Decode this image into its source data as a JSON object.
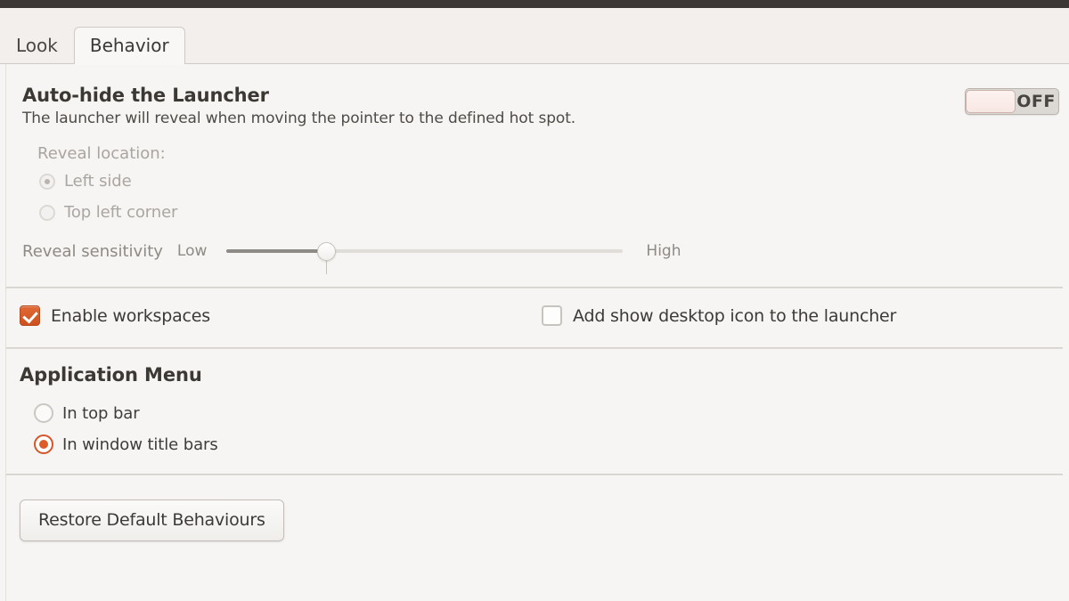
{
  "window": {
    "titlebar_color": "#3a3734"
  },
  "tabs": [
    {
      "label": "Look",
      "active": false
    },
    {
      "label": "Behavior",
      "active": true
    }
  ],
  "autohide": {
    "title": "Auto-hide the Launcher",
    "description": "The launcher will reveal when moving the pointer to the defined hot spot.",
    "toggle": {
      "state_label": "OFF",
      "on": false
    },
    "reveal_location_label": "Reveal location:",
    "reveal_options": [
      {
        "label": "Left side",
        "selected": true,
        "disabled": true
      },
      {
        "label": "Top left corner",
        "selected": false,
        "disabled": true
      }
    ],
    "sensitivity": {
      "label": "Reveal sensitivity",
      "min_label": "Low",
      "max_label": "High",
      "value_percent": 23
    }
  },
  "checkboxes": [
    {
      "label": "Enable workspaces",
      "checked": true
    },
    {
      "label": "Add show desktop icon to the launcher",
      "checked": false
    }
  ],
  "application_menu": {
    "title": "Application Menu",
    "options": [
      {
        "label": "In top bar",
        "selected": false
      },
      {
        "label": "In window title bars",
        "selected": true
      }
    ]
  },
  "restore_button": {
    "label": "Restore Default Behaviours"
  },
  "colors": {
    "accent_orange": "#dd5c28",
    "checkbox_orange": "#cf4f1d",
    "text_primary": "#3c3936",
    "text_muted": "#8e8a85",
    "text_disabled": "#aaa6a1",
    "panel_bg": "#f6f5f3",
    "tabstrip_bg": "#f2efec"
  }
}
